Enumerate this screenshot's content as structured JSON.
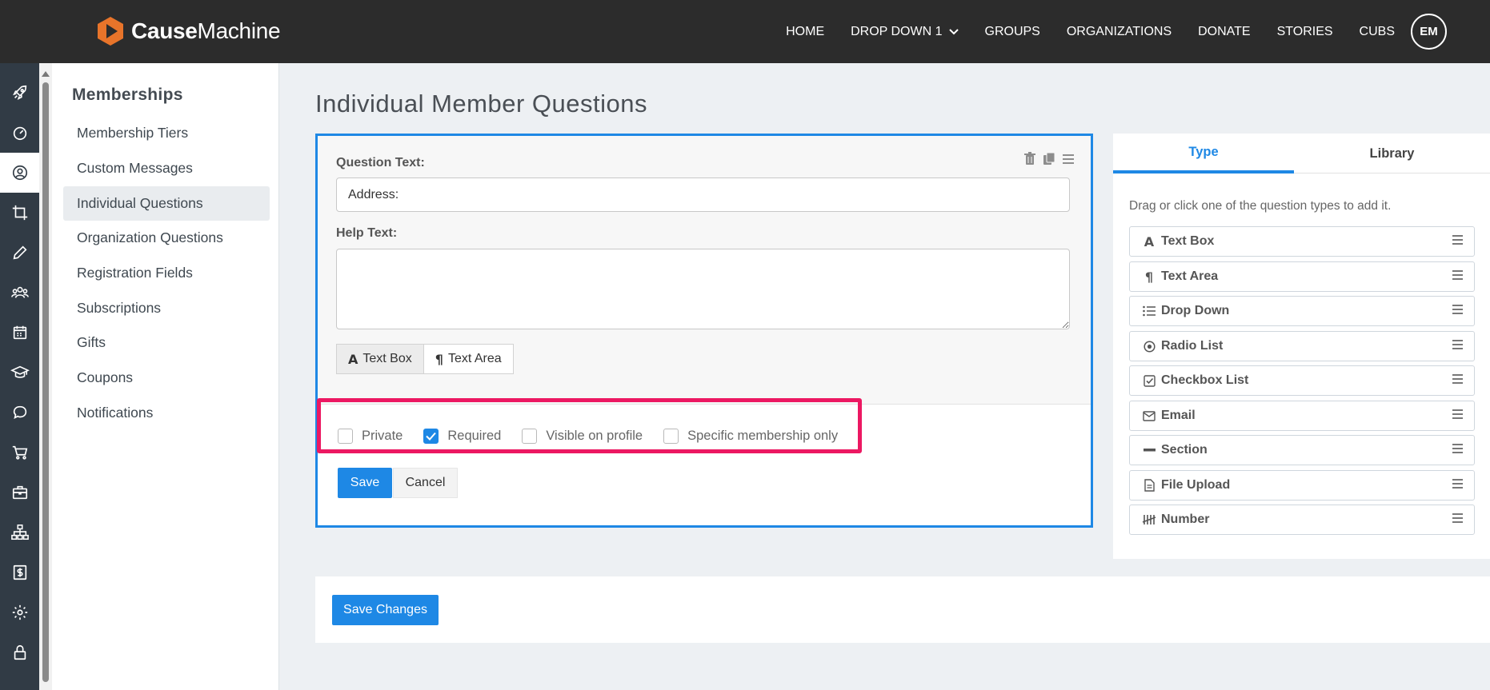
{
  "brand": {
    "name_part1": "Cause",
    "name_part2": "Machine",
    "logo_color": "#e8742a"
  },
  "topnav": {
    "items": [
      "HOME",
      "DROP DOWN 1",
      "GROUPS",
      "ORGANIZATIONS",
      "DONATE",
      "STORIES",
      "CUBS"
    ],
    "avatar_initials": "EM"
  },
  "rail": {
    "icons": [
      "rocket-icon",
      "dashboard-icon",
      "user-circle-icon",
      "crop-icon",
      "pencil-icon",
      "users-icon",
      "calendar-icon",
      "graduation-cap-icon",
      "chat-icon",
      "cart-icon",
      "briefcase-icon",
      "sitemap-icon",
      "dollar-icon",
      "gear-icon",
      "lock-icon"
    ],
    "active_icon": "user-circle-icon"
  },
  "subnav": {
    "title": "Memberships",
    "items": [
      "Membership Tiers",
      "Custom Messages",
      "Individual Questions",
      "Organization Questions",
      "Registration Fields",
      "Subscriptions",
      "Gifts",
      "Coupons",
      "Notifications"
    ],
    "active": "Individual Questions"
  },
  "main": {
    "title": "Individual Member Questions",
    "question": {
      "question_label": "Question Text:",
      "question_value": "Address:",
      "help_label": "Help Text:",
      "help_value": "",
      "type_buttons": [
        "Text Box",
        "Text Area"
      ],
      "active_type": "Text Box",
      "checkboxes": {
        "private": {
          "label": "Private",
          "checked": false
        },
        "required": {
          "label": "Required",
          "checked": true
        },
        "visible": {
          "label": "Visible on profile",
          "checked": false
        },
        "specific": {
          "label": "Specific membership only",
          "checked": false
        }
      },
      "save_label": "Save",
      "cancel_label": "Cancel"
    },
    "save_changes_label": "Save Changes"
  },
  "rightpanel": {
    "tabs": [
      "Type",
      "Library"
    ],
    "active_tab": "Type",
    "hint": "Drag or click one of the question types to add it.",
    "types": [
      "Text Box",
      "Text Area",
      "Drop Down",
      "Radio List",
      "Checkbox List",
      "Email",
      "Section",
      "File Upload",
      "Number"
    ]
  },
  "colors": {
    "accent": "#1e88e5",
    "highlight": "#ec1862",
    "topbar": "#2c2c2c",
    "rail": "#313b45"
  }
}
